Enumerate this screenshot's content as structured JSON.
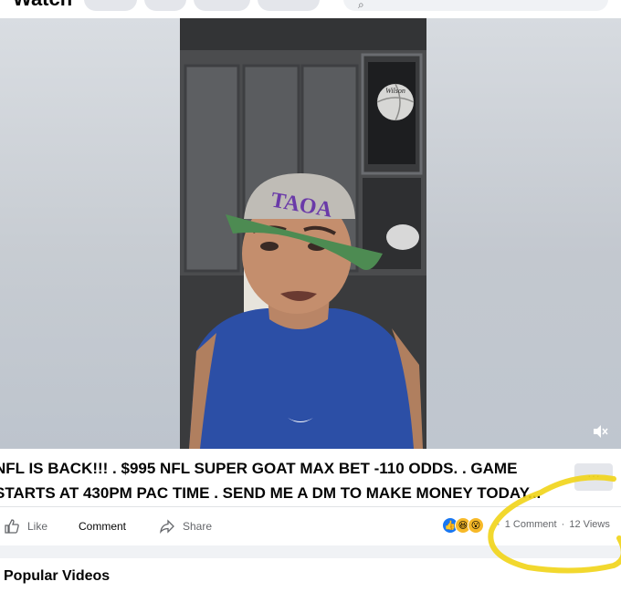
{
  "header": {
    "title": "Watch"
  },
  "post": {
    "caption_line1": "NFL IS BACK!!! . $995 NFL SUPER GOAT MAX BET -110 ODDS. . GAME",
    "caption_line2": "STARTS AT 430PM PAC TIME . SEND ME A DM TO MAKE MONEY TODAY...",
    "more_label": "···",
    "video_cap_text": "TAOA",
    "video_ball_text": "Wilson"
  },
  "actions": {
    "like": "Like",
    "comment": "Comment",
    "share": "Share"
  },
  "stats": {
    "comments": "1 Comment",
    "separator": "·",
    "views": "12 Views"
  },
  "popular": {
    "title": "Popular Videos"
  },
  "colors": {
    "highlight": "#f1d417",
    "like_blue": "#1877f2",
    "reaction_yellow": "#f7b928"
  }
}
